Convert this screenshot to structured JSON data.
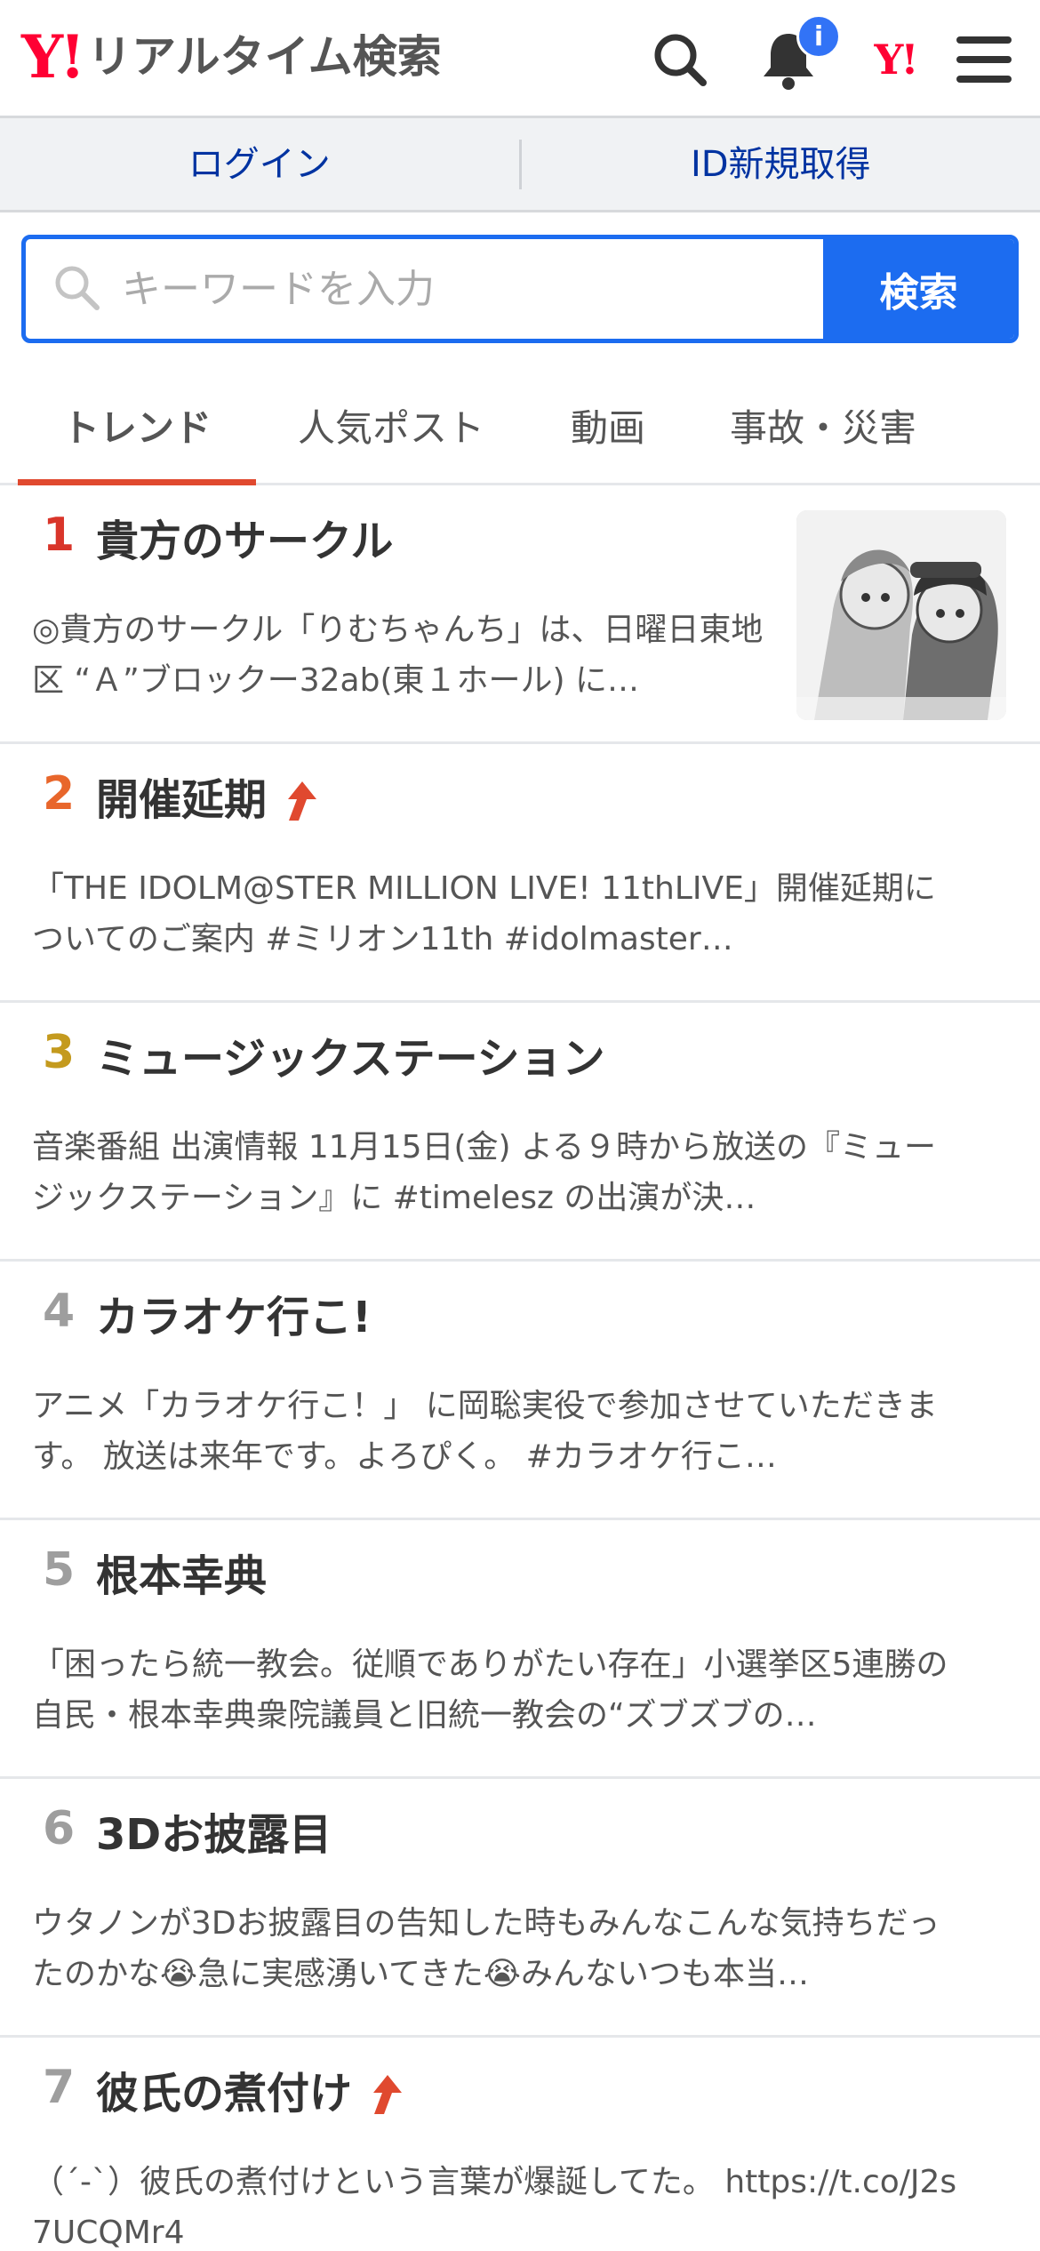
{
  "header": {
    "logo_mark": "Y!",
    "logo_text": "リアルタイム検索",
    "notification_count": "i",
    "yj_mark": "Y!"
  },
  "login_bar": {
    "login_label": "ログイン",
    "register_label": "ID新規取得"
  },
  "search": {
    "placeholder": "キーワードを入力",
    "button_label": "検索"
  },
  "tabs": [
    {
      "label": "トレンド",
      "active": true
    },
    {
      "label": "人気ポスト",
      "active": false
    },
    {
      "label": "動画",
      "active": false
    },
    {
      "label": "事故・災害",
      "active": false
    }
  ],
  "colors": {
    "brand_red": "#ff0033",
    "accent_blue": "#1c6cf0",
    "link_blue": "#0033a1",
    "tab_indicator": "#e0492f",
    "rank1": "#d9352a",
    "rank2": "#e8662b",
    "rank3": "#c49a1e",
    "rank_other": "#9e9e9e",
    "up_arrow": "#e0492f"
  },
  "trends": [
    {
      "rank": "1",
      "title": "貴方のサークル",
      "rising": false,
      "has_thumbnail": true,
      "description": "◎貴方のサークル「りむちゃんち」は、日曜日東地区 “Ａ”ブロックー32ab(東１ホール) に…"
    },
    {
      "rank": "2",
      "title": "開催延期",
      "rising": true,
      "has_thumbnail": false,
      "description": "「THE IDOLM@STER MILLION LIVE! 11thLIVE」開催延期についてのご案内 #ミリオン11th #idolmaster…"
    },
    {
      "rank": "3",
      "title": "ミュージックステーション",
      "rising": false,
      "has_thumbnail": false,
      "description": "󠁿󠁿音楽番組 出演情報 󠁿11月15日(金) よる９時から放送の『ミュージックステーション』に #timelesz の出演が決…"
    },
    {
      "rank": "4",
      "title": "カラオケ行こ!",
      "rising": false,
      "has_thumbnail": false,
      "description": "アニメ「カラオケ行こ！」 に岡聡実役で参加させていただきます。 放送は来年です。よろぴく。 #カラオケ行こ…"
    },
    {
      "rank": "5",
      "title": "根本幸典",
      "rising": false,
      "has_thumbnail": false,
      "description": "「困ったら統一教会。従順でありがたい存在」小選挙区5連勝の自民・根本幸典衆院議員と旧統一教会の“ズブズブの…"
    },
    {
      "rank": "6",
      "title": "3Dお披露目",
      "rising": false,
      "has_thumbnail": false,
      "description": "ウタノンが3Dお披露目の告知した時もみんなこんな気持ちだったのかな😭急に実感湧いてきた😭みんないつも本当…"
    },
    {
      "rank": "7",
      "title": "彼氏の煮付け",
      "rising": true,
      "has_thumbnail": false,
      "description": "（´-`）彼氏の煮付けという言葉が爆誕してた。 https://t.co/J2s7UCQMr4"
    }
  ]
}
